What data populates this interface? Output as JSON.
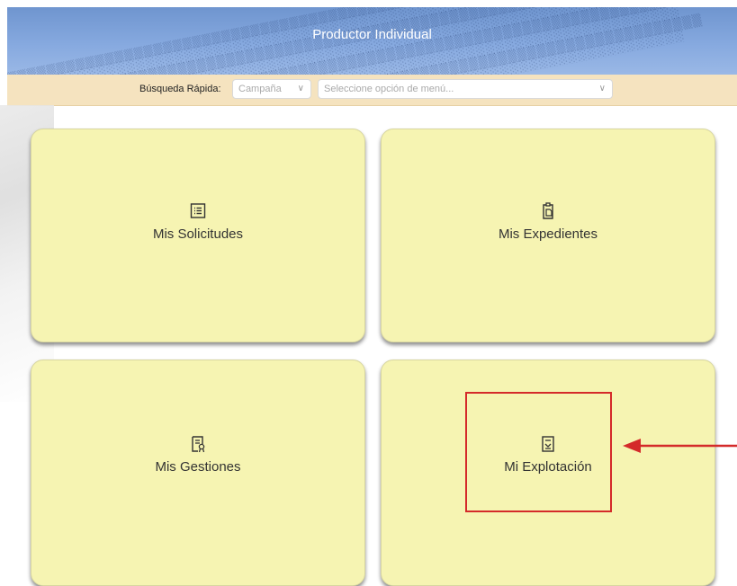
{
  "header": {
    "title": "Productor Individual"
  },
  "search": {
    "label": "Búsqueda Rápida:",
    "campaign_placeholder": "Campaña",
    "menu_placeholder": "Seleccione opción de menú..."
  },
  "cards": [
    {
      "label": "Mis Solicitudes",
      "icon": "list-icon"
    },
    {
      "label": "Mis Expedientes",
      "icon": "clipboard-copy-icon"
    },
    {
      "label": "Mis Gestiones",
      "icon": "certificate-icon"
    },
    {
      "label": "Mi Explotación",
      "icon": "document-download-icon"
    }
  ],
  "colors": {
    "header": "#7fa2da",
    "searchbar": "#f5e3bf",
    "card": "#f6f4b2",
    "annotation": "#d42a2a"
  }
}
